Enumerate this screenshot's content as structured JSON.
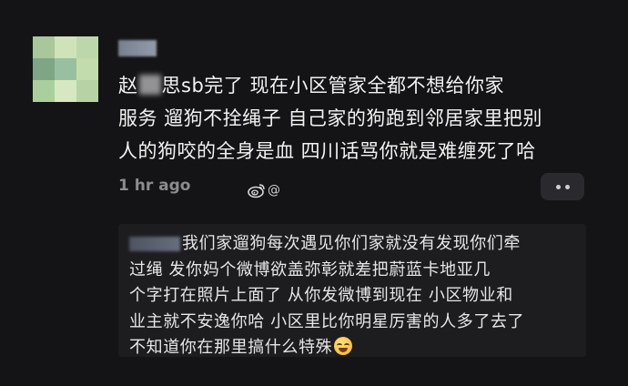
{
  "comment": {
    "avatar_colors": [
      "#a8c79a",
      "#cfe3b8",
      "#bcd8ab",
      "#7ea584",
      "#98c0a0",
      "#c2dcae",
      "#aacf9c",
      "#d6e8c2",
      "#b7d3a6"
    ],
    "text_prefix": "赵",
    "text_after_blur": "思sb完了 现在小区管家全都不想给你家",
    "line2": "服务 遛狗不拴绳子 自己家的狗跑到邻居家里把别",
    "line3": "人的狗咬的全身是血 四川话骂你就是难缠死了哈",
    "time": "1 hr ago",
    "weibo_suffix": "@"
  },
  "reply": {
    "line1": "我们家遛狗每次遇见你们家就没有发现你们牵",
    "line2": "过绳 发你妈个微博欲盖弥彰就差把蔚蓝卡地亚几",
    "line3": "个字打在照片上面了 从你发微博到现在 小区物业和",
    "line4": "业主就不安逸你哈 小区里比你明星厉害的人多了去了",
    "line5": "不知道你在那里搞什么特殊",
    "emoji_icon": "laughing-crying-emoji"
  }
}
